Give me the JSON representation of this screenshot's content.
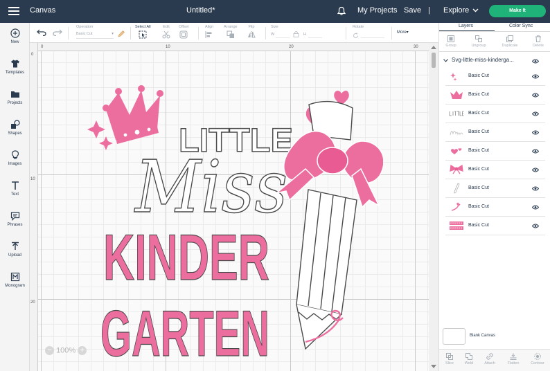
{
  "topbar": {
    "app_section": "Canvas",
    "doc_title": "Untitled*",
    "my_projects": "My Projects",
    "save": "Save",
    "separator": "|",
    "explore": "Explore",
    "make_it": "Make It",
    "colors": {
      "bar": "#2a3b4f",
      "make_it": "#1fb37a"
    }
  },
  "leftnav": {
    "items": [
      {
        "label": "New",
        "icon": "plus-circle-icon"
      },
      {
        "label": "Templates",
        "icon": "tshirt-icon"
      },
      {
        "label": "Projects",
        "icon": "folder-icon"
      },
      {
        "label": "Shapes",
        "icon": "shapes-icon"
      },
      {
        "label": "Images",
        "icon": "lightbulb-icon"
      },
      {
        "label": "Text",
        "icon": "text-t-icon"
      },
      {
        "label": "Phrases",
        "icon": "speech-bubble-icon"
      },
      {
        "label": "Upload",
        "icon": "upload-icon"
      },
      {
        "label": "Monogram",
        "icon": "monogram-icon"
      }
    ]
  },
  "toolbar": {
    "operation_label": "Operation",
    "operation_value": "Basic Cut",
    "select_all": "Select All",
    "edit": "Edit",
    "offset": "Offset",
    "align": "Align",
    "arrange": "Arrange",
    "flip": "Flip",
    "size": "Size",
    "size_w": "W",
    "size_h": "H",
    "rotate": "Rotate",
    "more": "More"
  },
  "canvas": {
    "ruler_top": [
      "0",
      "10",
      "20",
      "30"
    ],
    "ruler_left": [
      "0",
      "10",
      "20"
    ],
    "zoom": "100%",
    "artwork": {
      "line1": "LITTLE",
      "line2": "Miss",
      "line3": "KINDER",
      "line4": "GARTEN",
      "pink": "#ec6e9f",
      "pink_dark": "#e85b93",
      "outline": "#4a4a4a"
    }
  },
  "rightpanel": {
    "tabs": [
      "Layers",
      "Color Sync"
    ],
    "layer_tools": [
      "Group",
      "Ungroup",
      "Duplicate",
      "Delete"
    ],
    "group_name": "Svg-little-miss-kinderga...",
    "layers": [
      {
        "name": "Basic Cut",
        "thumb": "sparkles"
      },
      {
        "name": "Basic Cut",
        "thumb": "crown"
      },
      {
        "name": "Basic Cut",
        "thumb": "little-text"
      },
      {
        "name": "Basic Cut",
        "thumb": "miss-text"
      },
      {
        "name": "Basic Cut",
        "thumb": "hearts"
      },
      {
        "name": "Basic Cut",
        "thumb": "bow"
      },
      {
        "name": "Basic Cut",
        "thumb": "pencil"
      },
      {
        "name": "Basic Cut",
        "thumb": "swirl"
      },
      {
        "name": "Basic Cut",
        "thumb": "kinder-garten-text"
      }
    ],
    "blank_canvas": "Blank Canvas",
    "bottom_tools": [
      "Slice",
      "Weld",
      "Attach",
      "Flatten",
      "Contour"
    ]
  }
}
